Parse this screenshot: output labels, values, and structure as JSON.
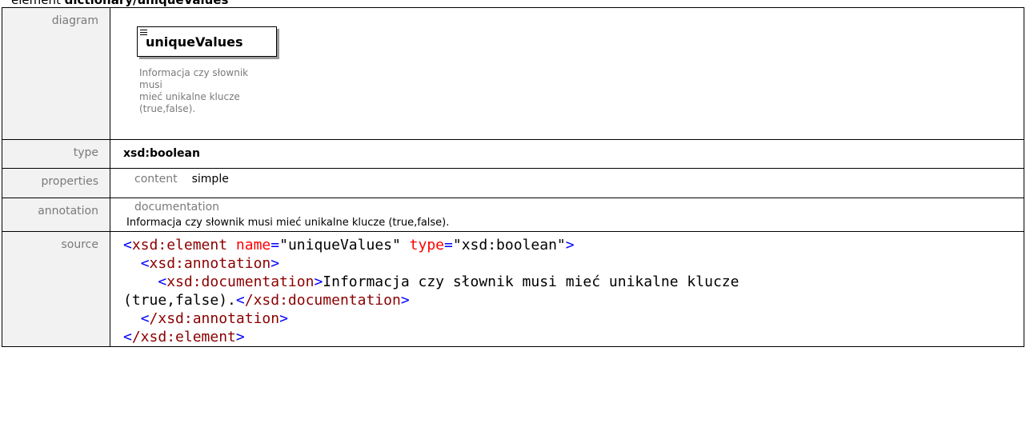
{
  "heading": {
    "prefix": "element ",
    "name": "dictionary/uniqueValues"
  },
  "rows": {
    "diagram": {
      "label": "diagram",
      "element_name": "uniqueValues",
      "doc_lines": [
        "Informacja czy słownik musi",
        "mieć unikalne klucze",
        "(true,false)."
      ]
    },
    "type": {
      "label": "type",
      "value": "xsd:boolean"
    },
    "properties": {
      "label": "properties",
      "key": "content",
      "value": "simple"
    },
    "annotation": {
      "label": "annotation",
      "key": "documentation",
      "value": "Informacja czy słownik musi mieć unikalne klucze (true,false)."
    },
    "source": {
      "label": "source",
      "element_tag": "xsd:element",
      "attr1_name": "name",
      "attr1_value": "\"uniqueValues\"",
      "attr2_name": "type",
      "attr2_value": "\"xsd:boolean\"",
      "annotation_tag": "xsd:annotation",
      "documentation_tag": "xsd:documentation",
      "doc_text_1": "Informacja czy słownik musi mieć unikalne klucze",
      "doc_text_2": "(true,false).",
      "close_documentation": "/xsd:documentation",
      "close_annotation": "/xsd:annotation",
      "close_element": "/xsd:element"
    }
  },
  "colors": {
    "bracket": "#0000ff",
    "tag": "#8b0000",
    "attribute": "#ff0000",
    "label": "#7a7a7a"
  }
}
